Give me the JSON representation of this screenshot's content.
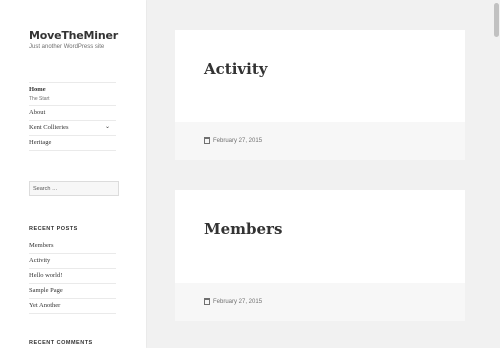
{
  "site": {
    "title": "MoveTheMiner",
    "description": "Just another WordPress site"
  },
  "nav": {
    "items": [
      {
        "label": "Home",
        "sub": "The Start"
      },
      {
        "label": "About"
      },
      {
        "label": "Kent Collieries"
      },
      {
        "label": "Heritage"
      }
    ],
    "chevron_icon": "chevron-down-icon"
  },
  "search": {
    "placeholder": "Search …"
  },
  "widgets": {
    "recent_posts_title": "RECENT POSTS",
    "recent_posts": [
      "Members",
      "Activity",
      "Hello world!",
      "Sample Page",
      "Yet Another"
    ],
    "recent_comments_title": "RECENT COMMENTS"
  },
  "posts": [
    {
      "title": "Activity",
      "date": "February 27, 2015"
    },
    {
      "title": "Members",
      "date": "February 27, 2015"
    }
  ]
}
